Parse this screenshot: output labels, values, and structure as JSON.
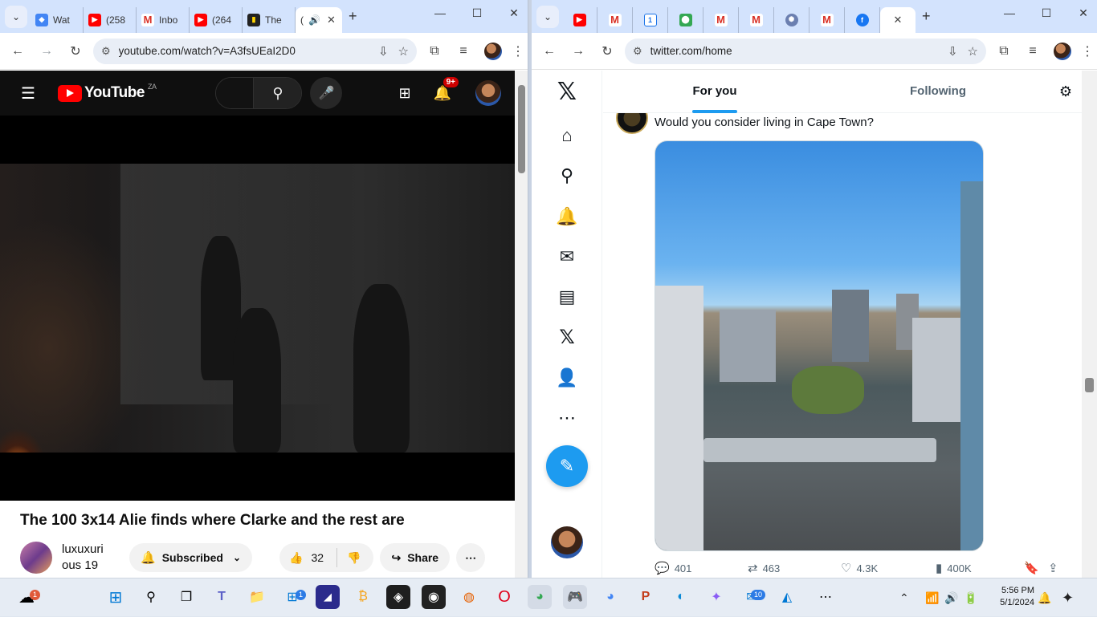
{
  "left_browser": {
    "tabs": [
      {
        "label": "Wat",
        "icon": "tab-favicon"
      },
      {
        "label": "(258",
        "icon": "youtube-icon"
      },
      {
        "label": "Inbo",
        "icon": "gmail-icon"
      },
      {
        "label": "(264",
        "icon": "youtube-icon"
      },
      {
        "label": "The",
        "icon": "document-icon"
      },
      {
        "label": "(",
        "icon": "speaker-icon",
        "active": true
      }
    ],
    "url": "youtube.com/watch?v=A3fsUEaI2D0",
    "youtube": {
      "logo_text": "YouTube",
      "country": "ZA",
      "notification_count": "9+",
      "video_title": "The 100 3x14 Alie finds where Clarke and the rest are",
      "channel_name": "luxuxuri",
      "channel_sub": "ous 19",
      "subscribed_label": "Subscribed",
      "like_count": "32",
      "share_label": "Share"
    }
  },
  "right_browser": {
    "tabs": [
      {
        "icon": "youtube-icon"
      },
      {
        "icon": "gmail-icon"
      },
      {
        "icon": "calendar-icon"
      },
      {
        "icon": "maps-icon"
      },
      {
        "icon": "gmail-icon"
      },
      {
        "icon": "gmail-icon"
      },
      {
        "icon": "ai-icon"
      },
      {
        "icon": "gmail-icon"
      },
      {
        "icon": "facebook-icon"
      },
      {
        "icon": "x-icon",
        "active": true
      }
    ],
    "url": "twitter.com/home",
    "twitter": {
      "tab_for_you": "For you",
      "tab_following": "Following",
      "tweet_text": "Would you consider living in Cape Town?",
      "replies": "401",
      "retweets": "463",
      "likes": "4.3K",
      "views": "400K"
    }
  },
  "taskbar": {
    "weather_badge": "1",
    "store_badge": "1",
    "mail_badge": "10",
    "time": "5:56 PM",
    "date": "5/1/2024"
  }
}
